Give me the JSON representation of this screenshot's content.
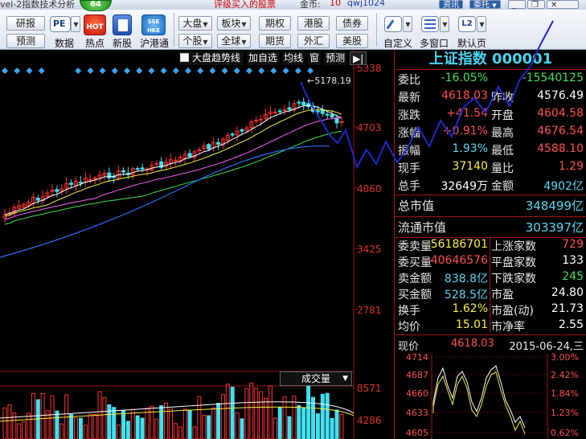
{
  "titlebar": {
    "app_title": "vel-2指数技术分析",
    "marquee": "评级买入的股票",
    "coin_label": "金币:",
    "coin_value": "10",
    "user": "qwj1024",
    "news_btn": "资讯",
    "order_btn": "委托"
  },
  "toolbar": {
    "research": "研报",
    "forecast": "预测",
    "data_label": "数据",
    "hot_label": "热点",
    "new_label": "新股",
    "hk_label": "沪港通",
    "market_groups": [
      [
        "大盘",
        "板块",
        "期权",
        "港股",
        "债券"
      ],
      [
        "个股",
        "全球",
        "期货",
        "外汇",
        "美股"
      ]
    ],
    "custom_label": "自定义",
    "multi_window_label": "多窗口",
    "default_page_label": "默认页",
    "pe_icon_text": "PE",
    "hot_icon_text": "HOT",
    "hk_icon_text": "SSE HKE",
    "l2_icon_text": "L2",
    "top_badge": "64"
  },
  "chart": {
    "menu": [
      "大盘趋势线",
      "加自选",
      "均线",
      "窗",
      "预测"
    ],
    "price_labels": [
      "5338",
      "4703",
      "4060",
      "3425",
      "2781"
    ],
    "high_annotation": "5178.19",
    "volume_tab": "成交量",
    "volume_labels": [
      "8571",
      "4286"
    ],
    "colors": {
      "up": "#ff3030",
      "down": "#40e0f0",
      "ma5": "#ffffff",
      "ma10": "#f5f23a",
      "ma20": "#ff5cff",
      "ma30": "#3de04f",
      "ma60": "#2a6af2",
      "drawn": "#1f28c8"
    }
  },
  "quote": {
    "title": "上证指数 000001",
    "rows": [
      {
        "l1": "委比",
        "v1": "-16.05%",
        "c1": "green",
        "l2": "",
        "v2": "-15540125",
        "c2": "green"
      },
      {
        "l1": "最新",
        "v1": "4618.03",
        "c1": "red",
        "l2": "昨收",
        "v2": "4576.49",
        "c2": "white"
      },
      {
        "l1": "涨跌",
        "v1": "+41.54",
        "c1": "red",
        "l2": "开盘",
        "v2": "4604.58",
        "c2": "red"
      },
      {
        "l1": "涨幅",
        "v1": "+0.91%",
        "c1": "red",
        "l2": "最高",
        "v2": "4676.54",
        "c2": "red"
      },
      {
        "l1": "振幅",
        "v1": "1.93%",
        "c1": "cyan",
        "l2": "最低",
        "v2": "4588.10",
        "c2": "red"
      },
      {
        "l1": "现手",
        "v1": "37140",
        "c1": "yellow",
        "l2": "量比",
        "v2": "1.29",
        "c2": "red"
      },
      {
        "l1": "总手",
        "v1": "32649万",
        "c1": "white",
        "l2": "金额",
        "v2": "4902亿",
        "c2": "cyan"
      }
    ],
    "market_value": {
      "label": "总市值",
      "value": "348499亿"
    },
    "float_value": {
      "label": "流通市值",
      "value": "303397亿"
    },
    "stats": [
      {
        "l1": "委卖量",
        "v1": "56186701",
        "c1": "yellow",
        "l2": "上涨家数",
        "v2": "729",
        "c2": "red"
      },
      {
        "l1": "委买量",
        "v1": "40646576",
        "c1": "red",
        "l2": "平盘家数",
        "v2": "133",
        "c2": "white"
      },
      {
        "l1": "卖金额",
        "v1": "838.8亿",
        "c1": "cyan",
        "l2": "下跌家数",
        "v2": "245",
        "c2": "green"
      },
      {
        "l1": "买金额",
        "v1": "528.5亿",
        "c1": "cyan",
        "l2": "市盈",
        "v2": "24.80",
        "c2": "white"
      },
      {
        "l1": "换手",
        "v1": "1.62%",
        "c1": "yellow",
        "l2": "市盈(动)",
        "v2": "21.73",
        "c2": "white"
      },
      {
        "l1": "均价",
        "v1": "15.01",
        "c1": "yellow",
        "l2": "市净率",
        "v2": "2.55",
        "c2": "white"
      }
    ],
    "mini": {
      "label": "现价",
      "value": "4618.03",
      "date": "2015-06-24,三",
      "left_labels": [
        "4714",
        "4687",
        "4660",
        "4633",
        "4605"
      ],
      "right_labels": [
        "3.00%",
        "2.42%",
        "1.84%",
        "1.23%",
        "0.62%"
      ]
    }
  }
}
